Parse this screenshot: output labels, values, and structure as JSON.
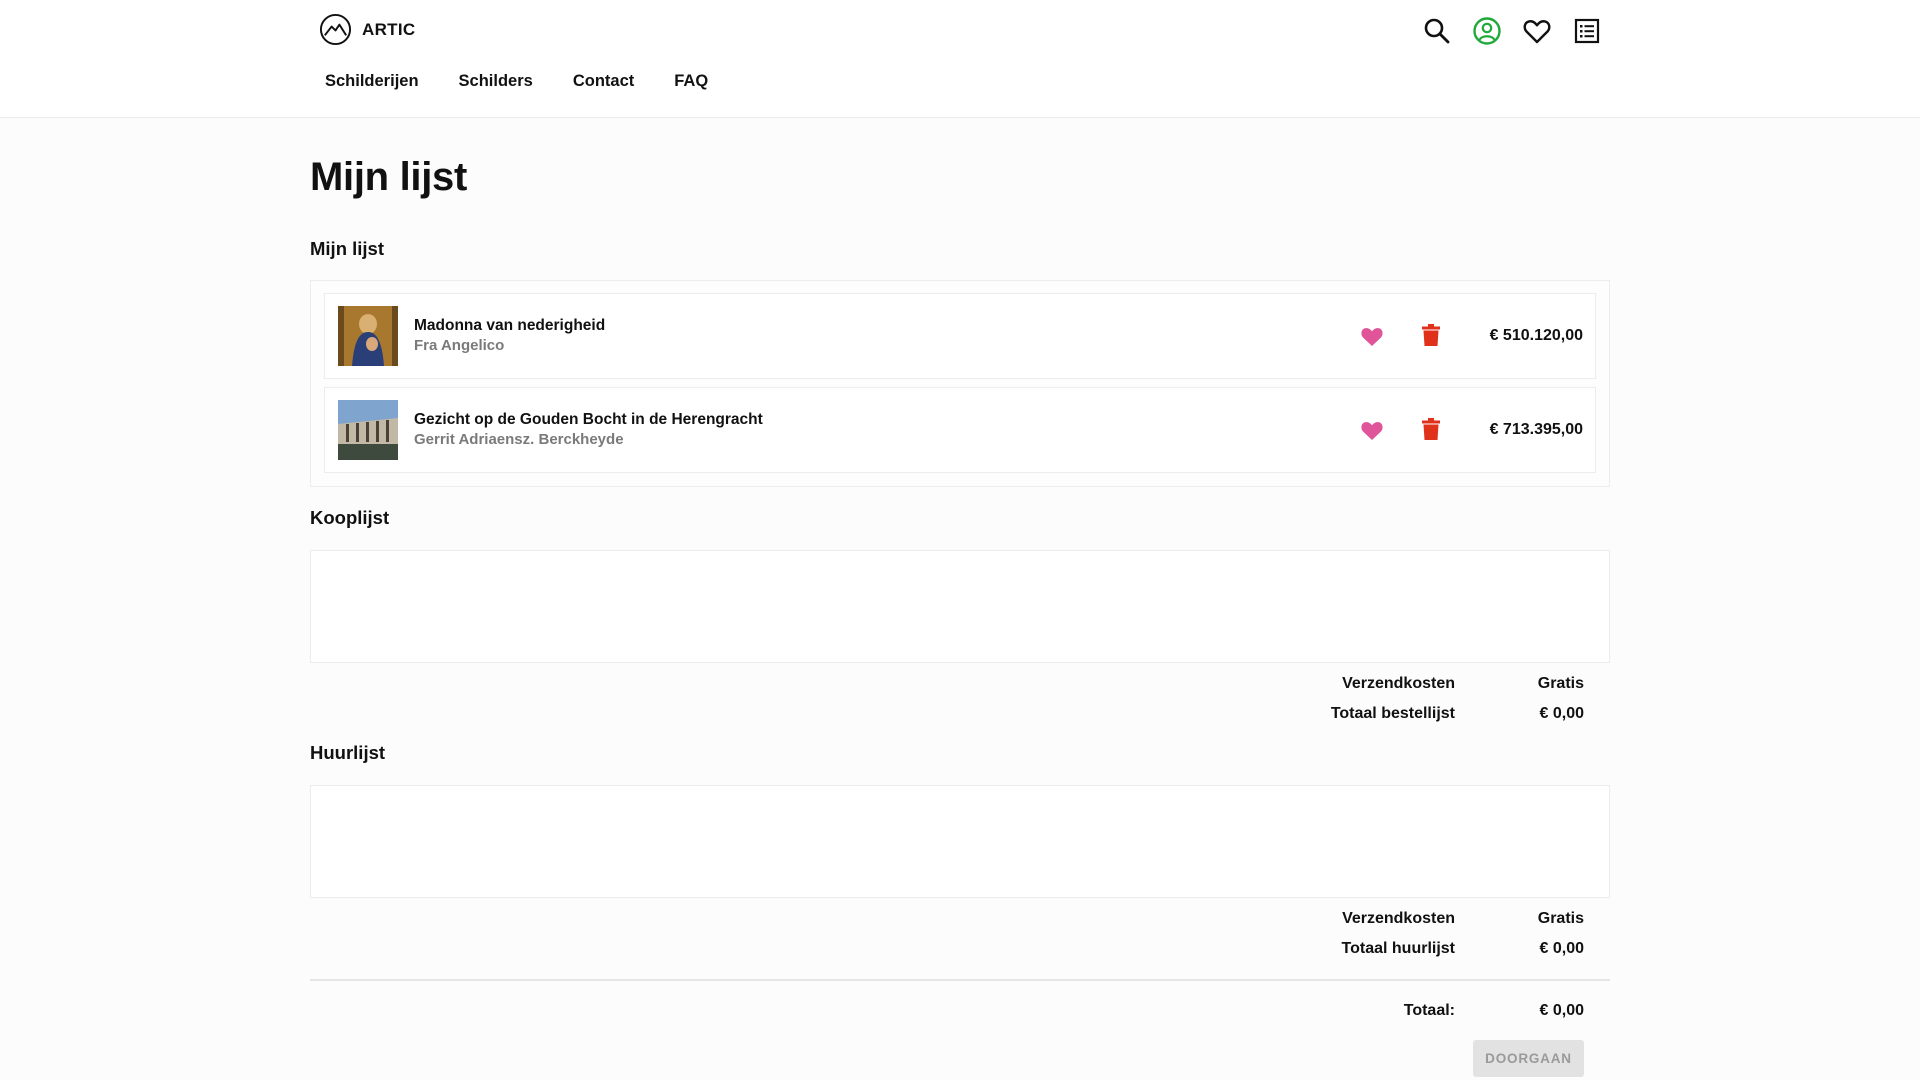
{
  "brand": {
    "name": "ARTIC",
    "logo_icon": "mountain-circle-icon"
  },
  "nav": [
    {
      "label": "Schilderijen"
    },
    {
      "label": "Schilders"
    },
    {
      "label": "Contact"
    },
    {
      "label": "FAQ"
    }
  ],
  "header_icons": [
    "search-icon",
    "user-circle-icon",
    "heart-icon",
    "list-icon"
  ],
  "colors": {
    "heart": "#e0559a",
    "trash": "#e0311b",
    "user": "#1ea93a"
  },
  "page_title": "Mijn lijst",
  "wishlist": {
    "title": "Mijn lijst",
    "items": [
      {
        "title": "Madonna van nederigheid",
        "artist": "Fra Angelico",
        "price": "€ 510.120,00"
      },
      {
        "title": "Gezicht op de Gouden Bocht in de Herengracht",
        "artist": "Gerrit Adriaensz. Berckheyde",
        "price": "€ 713.395,00"
      }
    ]
  },
  "buy_list": {
    "title": "Kooplijst",
    "shipping_label": "Verzendkosten",
    "shipping_value": "Gratis",
    "total_label": "Totaal bestellijst",
    "total_value": "€ 0,00"
  },
  "rent_list": {
    "title": "Huurlijst",
    "shipping_label": "Verzendkosten",
    "shipping_value": "Gratis",
    "total_label": "Totaal huurlijst",
    "total_value": "€ 0,00"
  },
  "grand_total": {
    "label": "Totaal:",
    "value": "€ 0,00"
  },
  "continue_button": "DOORGAAN"
}
